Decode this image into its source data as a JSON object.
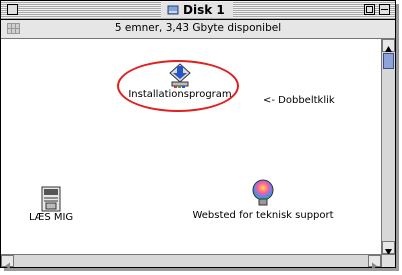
{
  "window": {
    "title": "Disk 1",
    "status": "5 emner, 3,43 Gbyte disponibel"
  },
  "items": {
    "installer": {
      "label": "Installationsprogram",
      "icon": "installer-icon"
    },
    "hint": {
      "label": "<- Dobbeltklik"
    },
    "readme": {
      "label": "LÆS MIG",
      "icon": "document-icon"
    },
    "support": {
      "label": "Websted for teknisk support",
      "icon": "lightbulb-icon"
    }
  },
  "colors": {
    "annotation": "#e02020",
    "scroll_thumb": "#8ea3d6",
    "title_bar": "#a8a8a8"
  }
}
